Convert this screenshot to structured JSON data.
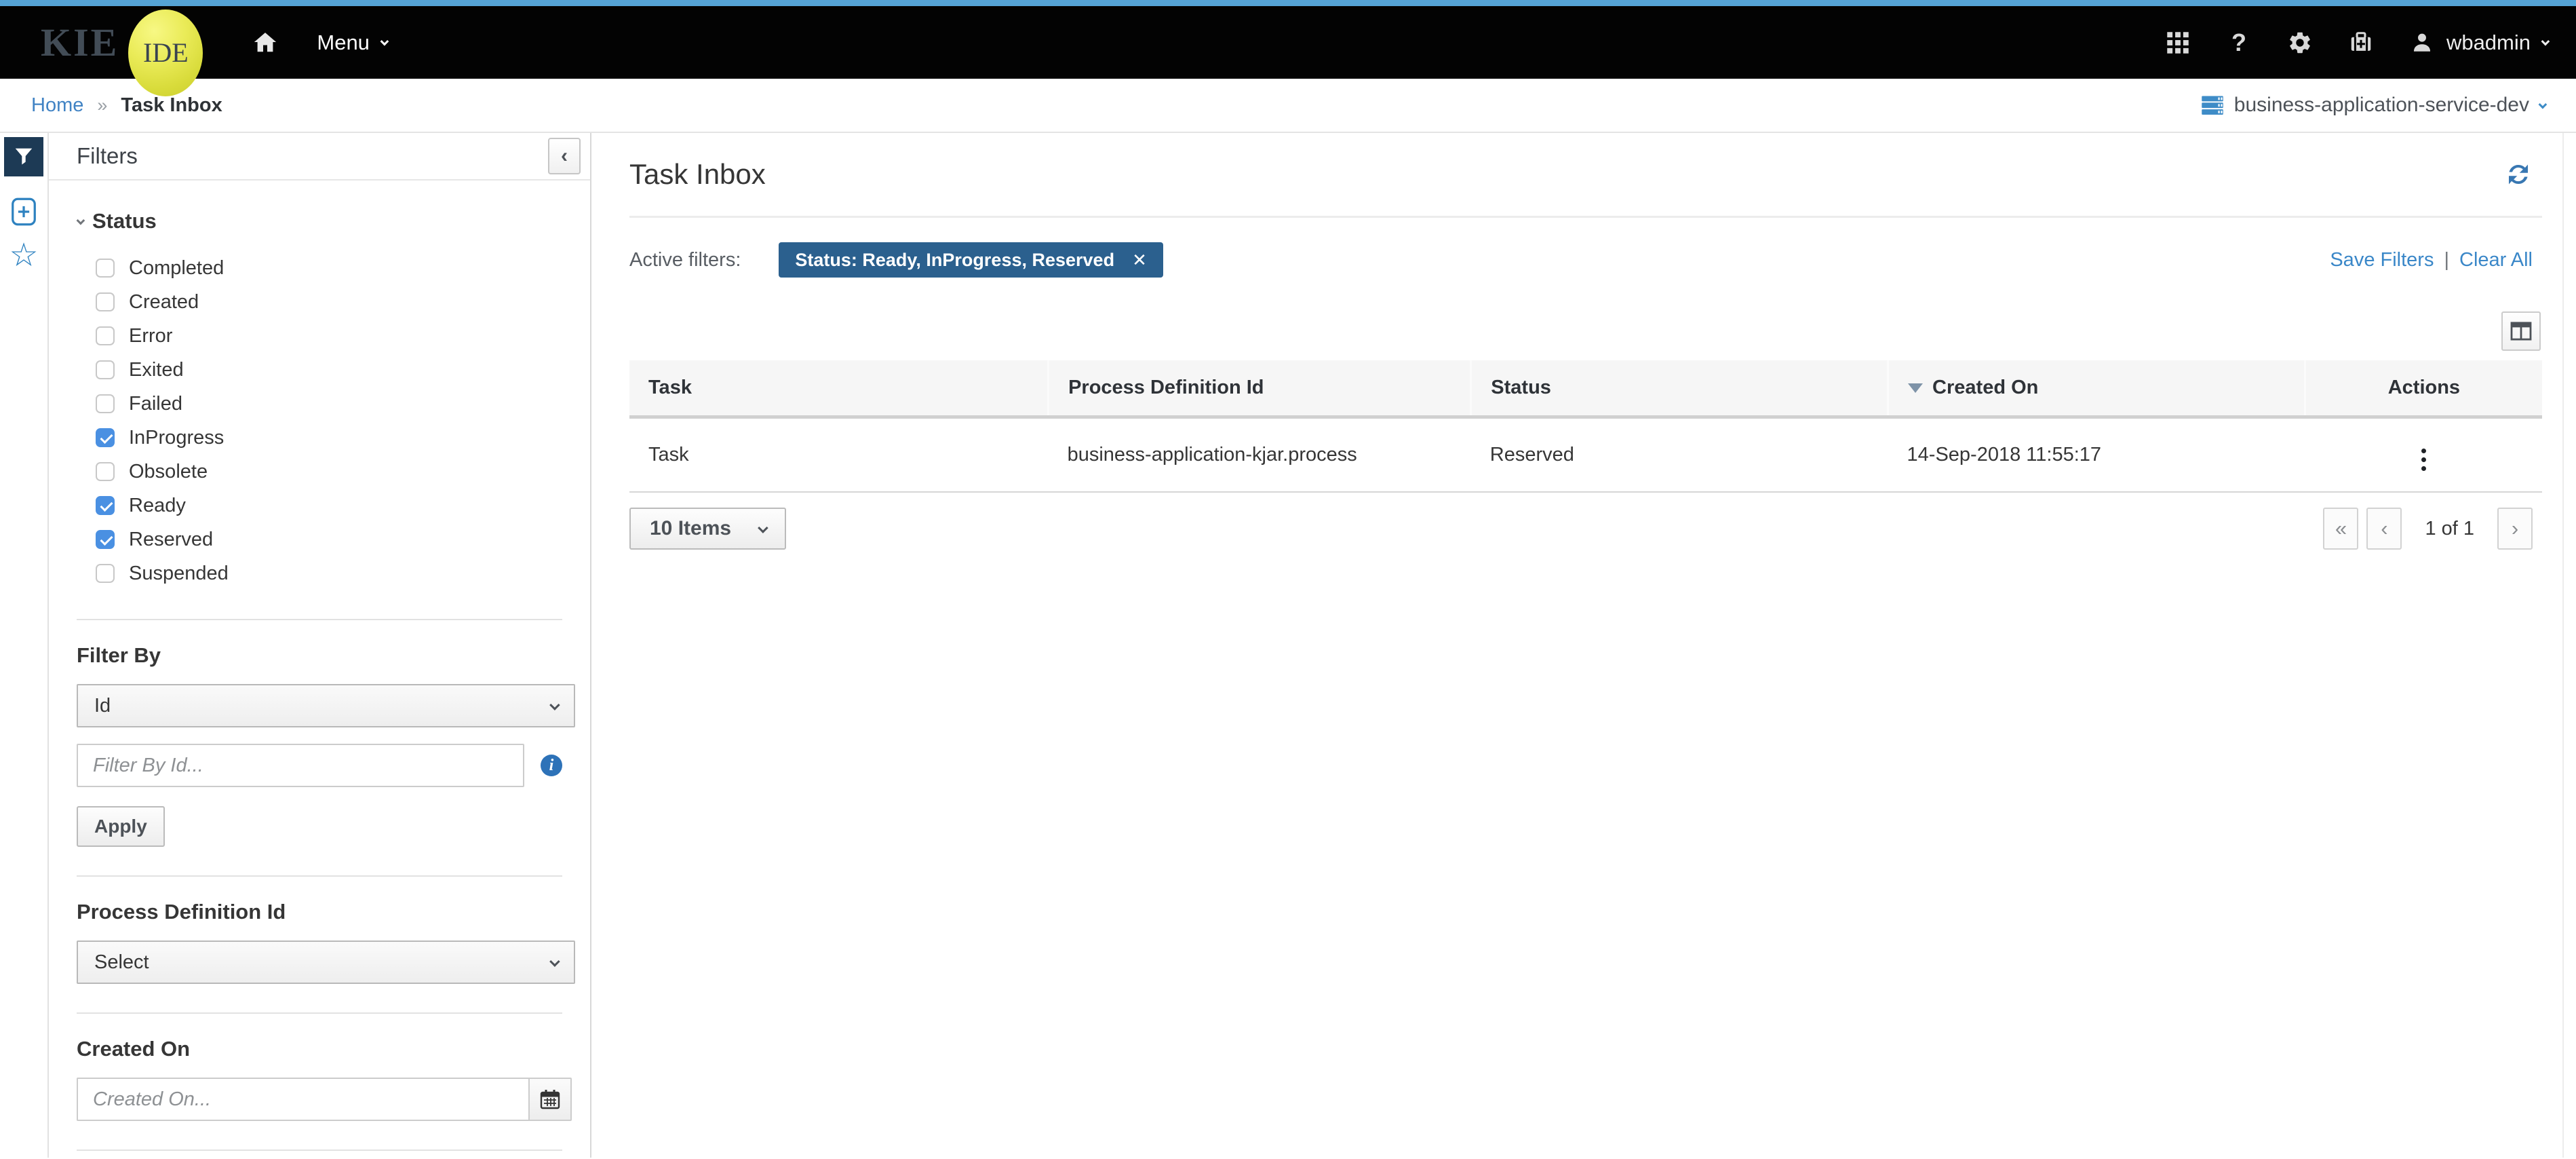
{
  "navbar": {
    "logo": {
      "kie": "KIE",
      "ide": "IDE"
    },
    "menu": "Menu",
    "help": "?",
    "user": "wbadmin"
  },
  "breadcrumb": {
    "home": "Home",
    "separator": "»",
    "current": "Task Inbox",
    "server_select": "business-application-service-dev"
  },
  "filters_panel": {
    "title": "Filters",
    "collapse": "‹",
    "status": {
      "label": "Status",
      "options": [
        {
          "label": "Completed",
          "checked": false
        },
        {
          "label": "Created",
          "checked": false
        },
        {
          "label": "Error",
          "checked": false
        },
        {
          "label": "Exited",
          "checked": false
        },
        {
          "label": "Failed",
          "checked": false
        },
        {
          "label": "InProgress",
          "checked": true
        },
        {
          "label": "Obsolete",
          "checked": false
        },
        {
          "label": "Ready",
          "checked": true
        },
        {
          "label": "Reserved",
          "checked": true
        },
        {
          "label": "Suspended",
          "checked": false
        }
      ]
    },
    "filter_by": {
      "label": "Filter By",
      "selected": "Id",
      "placeholder": "Filter By Id...",
      "apply": "Apply"
    },
    "process_definition_id": {
      "label": "Process Definition Id",
      "selected": "Select"
    },
    "created_on": {
      "label": "Created On",
      "placeholder": "Created On..."
    }
  },
  "main": {
    "title": "Task Inbox",
    "active_filters": {
      "label": "Active filters:",
      "filter_chip": "Status: Ready, InProgress, Reserved",
      "remove": "✕",
      "save_filters": "Save Filters",
      "link_separator": "|",
      "clear_all": "Clear All"
    },
    "table": {
      "columns": [
        "Task",
        "Process Definition Id",
        "Status",
        "Created On",
        "Actions"
      ],
      "sorted_column": "Created On",
      "rows": [
        {
          "task": "Task",
          "process_definition_id": "business-application-kjar.process",
          "status": "Reserved",
          "created_on": "14-Sep-2018 11:55:17"
        }
      ]
    },
    "pagination": {
      "page_size": "10 Items",
      "first": "«",
      "prev": "‹",
      "page_info": "1 of 1",
      "next": "›"
    }
  },
  "colors": {
    "top_strip": "#55a3d5",
    "navbar": "#030303",
    "logo_yellow": "#e3e54a",
    "chip_blue": "#2b608e",
    "checkbox_blue": "#4a90e2",
    "link_blue": "#3a87c8",
    "rail_active": "#1d3a55",
    "icon_blue": "#2e82c0"
  }
}
